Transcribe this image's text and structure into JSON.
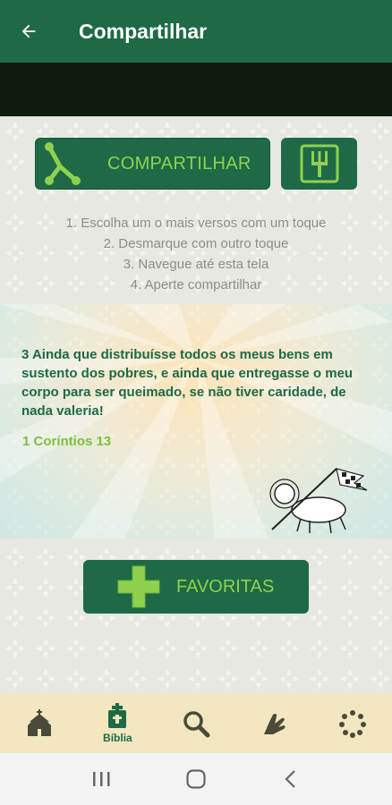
{
  "appbar": {
    "title": "Compartilhar"
  },
  "share_button": {
    "label": "COMPARTILHAR"
  },
  "instructions": [
    "1. Escolha um o mais versos com um toque",
    "2. Desmarque com outro toque",
    "3. Navegue até esta tela",
    "4. Aperte compartilhar"
  ],
  "verse": {
    "text": "3 Ainda que distribuísse todos os meus bens em sustento dos pobres, e ainda que entregasse o meu corpo para ser queimado, se não tiver caridade, de nada valeria!",
    "reference": "1 Coríntios 13"
  },
  "favorites_button": {
    "label": "FAVORITAS"
  },
  "bottom_nav": {
    "items": [
      {
        "icon": "church-icon",
        "label": ""
      },
      {
        "icon": "bible-icon",
        "label": "Bíblia"
      },
      {
        "icon": "search-icon",
        "label": ""
      },
      {
        "icon": "praying-hands-icon",
        "label": ""
      },
      {
        "icon": "rosary-icon",
        "label": ""
      }
    ]
  },
  "colors": {
    "primary": "#1e6a46",
    "accent": "#8fd14f",
    "nav_bg": "#f2e7c1"
  }
}
